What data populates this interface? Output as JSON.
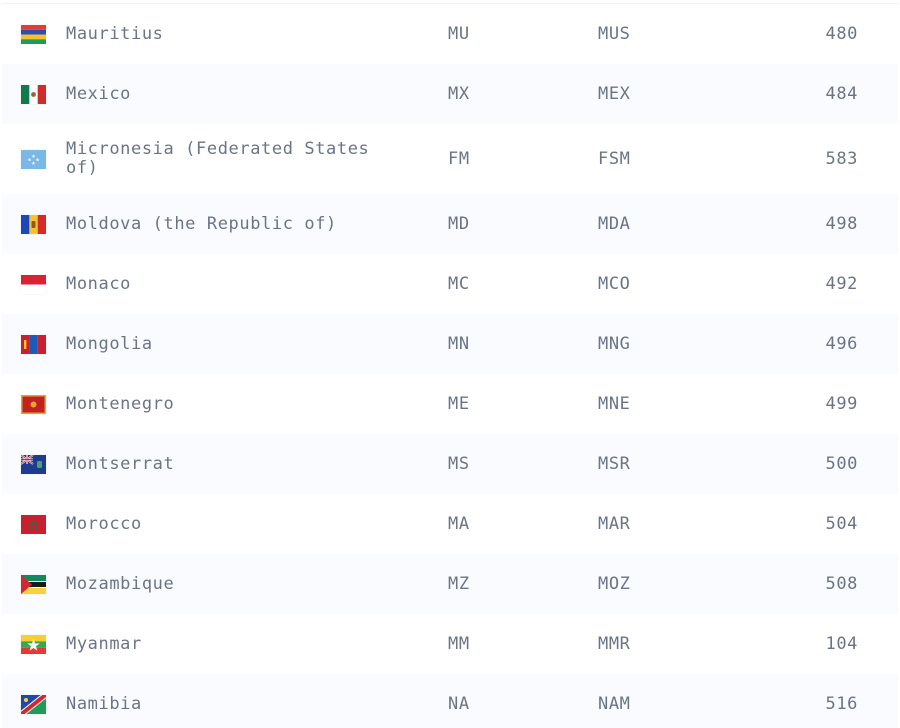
{
  "rows": [
    {
      "name": "Mauritius",
      "alpha2": "MU",
      "alpha3": "MUS",
      "numeric": "480",
      "flag_icon": "flag-mauritius-icon",
      "colors": [
        "#e63b32",
        "#2b4fb1",
        "#f6c12a",
        "#1f9d57"
      ]
    },
    {
      "name": "Mexico",
      "alpha2": "MX",
      "alpha3": "MEX",
      "numeric": "484",
      "flag_icon": "flag-mexico-icon",
      "colors": [
        "#0f7a4a",
        "#ffffff",
        "#cf2b2b"
      ]
    },
    {
      "name": "Micronesia (Federated States of)",
      "alpha2": "FM",
      "alpha3": "FSM",
      "numeric": "583",
      "flag_icon": "flag-micronesia-icon",
      "colors": [
        "#7ab8e6",
        "#ffffff"
      ]
    },
    {
      "name": "Moldova (the Republic of)",
      "alpha2": "MD",
      "alpha3": "MDA",
      "numeric": "498",
      "flag_icon": "flag-moldova-icon",
      "colors": [
        "#1c47b6",
        "#f4c430",
        "#d62a2a"
      ]
    },
    {
      "name": "Monaco",
      "alpha2": "MC",
      "alpha3": "MCO",
      "numeric": "492",
      "flag_icon": "flag-monaco-icon",
      "colors": [
        "#d92332",
        "#ffffff"
      ]
    },
    {
      "name": "Mongolia",
      "alpha2": "MN",
      "alpha3": "MNG",
      "numeric": "496",
      "flag_icon": "flag-mongolia-icon",
      "colors": [
        "#c8202f",
        "#1c5bb8",
        "#f4c430"
      ]
    },
    {
      "name": "Montenegro",
      "alpha2": "ME",
      "alpha3": "MNE",
      "numeric": "499",
      "flag_icon": "flag-montenegro-icon",
      "colors": [
        "#e3a82b",
        "#c22121"
      ]
    },
    {
      "name": "Montserrat",
      "alpha2": "MS",
      "alpha3": "MSR",
      "numeric": "500",
      "flag_icon": "flag-montserrat-icon",
      "colors": [
        "#1d3b8f",
        "#cf2b2b",
        "#ffffff"
      ]
    },
    {
      "name": "Morocco",
      "alpha2": "MA",
      "alpha3": "MAR",
      "numeric": "504",
      "flag_icon": "flag-morocco-icon",
      "colors": [
        "#c8202f",
        "#0f7a4a"
      ]
    },
    {
      "name": "Mozambique",
      "alpha2": "MZ",
      "alpha3": "MOZ",
      "numeric": "508",
      "flag_icon": "flag-mozambique-icon",
      "colors": [
        "#0f8a5f",
        "#1b1b1b",
        "#f4d43a",
        "#d6262d"
      ]
    },
    {
      "name": "Myanmar",
      "alpha2": "MM",
      "alpha3": "MMR",
      "numeric": "104",
      "flag_icon": "flag-myanmar-icon",
      "colors": [
        "#f7cf2e",
        "#34a853",
        "#e53935"
      ]
    },
    {
      "name": "Namibia",
      "alpha2": "NA",
      "alpha3": "NAM",
      "numeric": "516",
      "flag_icon": "flag-namibia-icon",
      "colors": [
        "#1f4aa8",
        "#d6262d",
        "#1f9d57"
      ]
    }
  ]
}
